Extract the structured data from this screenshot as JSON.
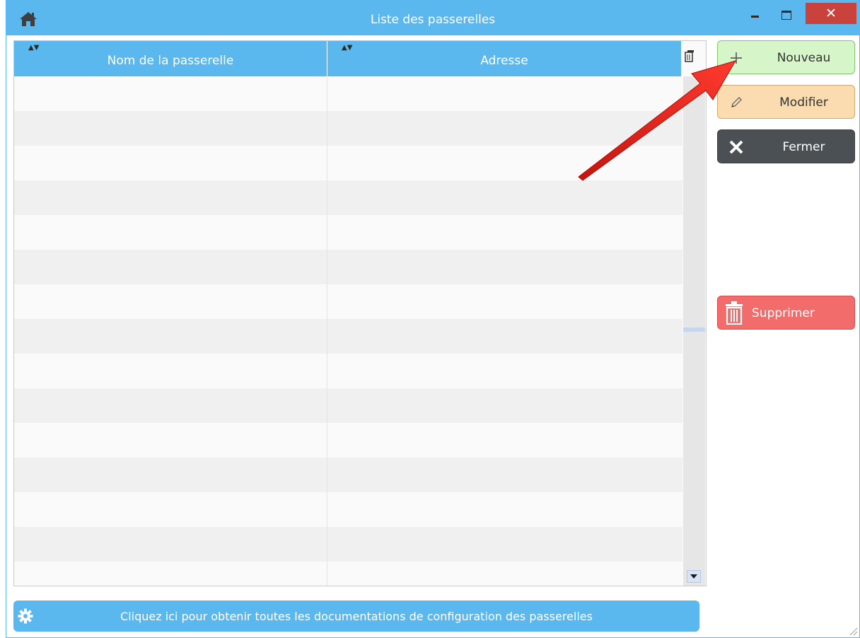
{
  "window": {
    "title": "Liste des passerelles",
    "close_glyph": "✕",
    "accent": "#5ab8ef"
  },
  "grid": {
    "columns": [
      {
        "label": "Nom de la passerelle"
      },
      {
        "label": "Adresse"
      }
    ],
    "sort_glyph": "▲▼"
  },
  "buttons": {
    "new": {
      "label": "Nouveau",
      "icon": "plus-icon"
    },
    "edit": {
      "label": "Modifier",
      "icon": "pencil-icon"
    },
    "close": {
      "label": "Fermer",
      "icon": "x-icon"
    },
    "delete": {
      "label": "Supprimer",
      "icon": "trash-icon"
    }
  },
  "footer": {
    "doc_link": "Cliquez ici pour obtenir toutes les documentations de configuration des passerelles",
    "icon": "gear-icon"
  },
  "annotation": {
    "icon": "red-arrow",
    "color": "#e8201a"
  }
}
